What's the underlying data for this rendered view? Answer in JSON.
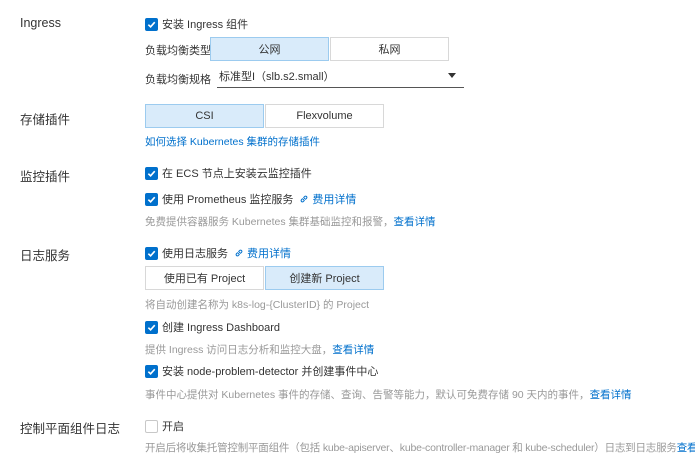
{
  "ingress": {
    "section_label": "Ingress",
    "install_label": "安装 Ingress 组件",
    "install_checked": true,
    "lb_type_label": "负载均衡类型",
    "lb_type_options": [
      "公网",
      "私网"
    ],
    "lb_type_selected": "公网",
    "lb_spec_label": "负载均衡规格",
    "lb_spec_value": "标准型I（slb.s2.small）"
  },
  "storage": {
    "section_label": "存储插件",
    "options": [
      "CSI",
      "Flexvolume"
    ],
    "selected": "CSI",
    "help_link": "如何选择 Kubernetes 集群的存储插件"
  },
  "monitor": {
    "section_label": "监控插件",
    "ecs_agent_label": "在 ECS 节点上安装云监控插件",
    "ecs_agent_checked": true,
    "prometheus_label": "使用 Prometheus 监控服务",
    "prometheus_checked": true,
    "cost_link": "费用详情",
    "hint": "免费提供容器服务 Kubernetes 集群基础监控和报警，",
    "hint_link": "查看详情"
  },
  "logging": {
    "section_label": "日志服务",
    "use_log_label": "使用日志服务",
    "use_log_checked": true,
    "cost_link": "费用详情",
    "project_options": [
      "使用已有 Project",
      "创建新 Project"
    ],
    "project_selected": "创建新 Project",
    "project_hint": "将自动创建名称为 k8s-log-{ClusterID} 的 Project",
    "dashboard_label": "创建 Ingress Dashboard",
    "dashboard_checked": true,
    "dashboard_hint": "提供 Ingress 访问日志分析和监控大盘，",
    "dashboard_hint_link": "查看详情",
    "npd_label": "安装 node-problem-detector 并创建事件中心",
    "npd_checked": true,
    "npd_hint": "事件中心提供对 Kubernetes 事件的存储、查询、告警等能力，默认可免费存储 90 天内的事件，",
    "npd_hint_link": "查看详情"
  },
  "control_plane": {
    "section_label": "控制平面组件日志",
    "enable_label": "开启",
    "enable_checked": false,
    "hint": "开启后将收集托管控制平面组件（包括 kube-apiserver、kube-controller-manager 和 kube-scheduler）日志到日志服务",
    "hint_link": "查看详情"
  },
  "colors": {
    "accent": "#0070cc",
    "active_segment_bg": "#d9ebfa",
    "hint_text": "#999999"
  }
}
